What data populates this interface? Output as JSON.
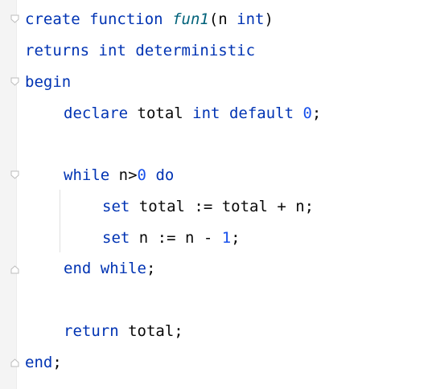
{
  "editor": {
    "lines": [
      {
        "tokens": [
          {
            "text": "create",
            "kind": "kw"
          },
          {
            "text": " ",
            "kind": "id"
          },
          {
            "text": "function",
            "kind": "kw"
          },
          {
            "text": " ",
            "kind": "id"
          },
          {
            "text": "fun1",
            "kind": "fn"
          },
          {
            "text": "(n ",
            "kind": "id"
          },
          {
            "text": "int",
            "kind": "kw"
          },
          {
            "text": ")",
            "kind": "id"
          }
        ]
      },
      {
        "tokens": [
          {
            "text": "returns",
            "kind": "kw"
          },
          {
            "text": " ",
            "kind": "id"
          },
          {
            "text": "int",
            "kind": "kw"
          },
          {
            "text": " ",
            "kind": "id"
          },
          {
            "text": "deterministic",
            "kind": "kw"
          }
        ]
      },
      {
        "tokens": [
          {
            "text": "begin",
            "kind": "kw"
          }
        ]
      },
      {
        "tokens": [
          {
            "text": "declare",
            "kind": "kw"
          },
          {
            "text": " total ",
            "kind": "id"
          },
          {
            "text": "int",
            "kind": "kw"
          },
          {
            "text": " ",
            "kind": "id"
          },
          {
            "text": "default",
            "kind": "kw"
          },
          {
            "text": " ",
            "kind": "id"
          },
          {
            "text": "0",
            "kind": "num"
          },
          {
            "text": ";",
            "kind": "id"
          }
        ]
      },
      {
        "tokens": [
          {
            "text": "while",
            "kind": "kw"
          },
          {
            "text": " n>",
            "kind": "id"
          },
          {
            "text": "0",
            "kind": "num"
          },
          {
            "text": " ",
            "kind": "id"
          },
          {
            "text": "do",
            "kind": "kw"
          }
        ]
      },
      {
        "tokens": [
          {
            "text": "set",
            "kind": "kw"
          },
          {
            "text": " total := total + n;",
            "kind": "id"
          }
        ]
      },
      {
        "tokens": [
          {
            "text": "set",
            "kind": "kw"
          },
          {
            "text": " n := n - ",
            "kind": "id"
          },
          {
            "text": "1",
            "kind": "num"
          },
          {
            "text": ";",
            "kind": "id"
          }
        ]
      },
      {
        "tokens": [
          {
            "text": "end",
            "kind": "kw"
          },
          {
            "text": " ",
            "kind": "id"
          },
          {
            "text": "while",
            "kind": "kw"
          },
          {
            "text": ";",
            "kind": "id"
          }
        ]
      },
      {
        "tokens": [
          {
            "text": "return",
            "kind": "kw"
          },
          {
            "text": " total;",
            "kind": "id"
          }
        ]
      },
      {
        "tokens": [
          {
            "text": "end",
            "kind": "kw"
          },
          {
            "text": ";",
            "kind": "id"
          }
        ]
      }
    ]
  },
  "colors": {
    "keyword": "#0033b3",
    "function_name": "#00627a",
    "number": "#1750eb",
    "identifier": "#080808",
    "background": "#ffffff",
    "gutter": "#f4f4f4"
  },
  "icons": {
    "fold_open": "fold-open-icon",
    "fold_close": "fold-close-icon"
  }
}
